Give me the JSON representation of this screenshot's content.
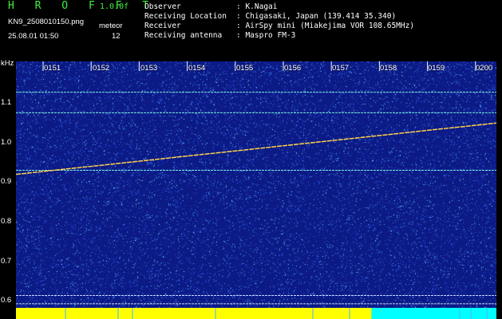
{
  "header": {
    "logo": "H R O F F T",
    "version": "1.0.0f",
    "filename": "KN9_2508010150.png",
    "datetime": "25.08.01 01:50",
    "meteor_label": "meteor",
    "meteor_count": "12",
    "info": [
      {
        "key": "Observer",
        "value": ": K.Nagai"
      },
      {
        "key": "Receiving Location",
        "value": ": Chigasaki, Japan (139.414 35.340)"
      },
      {
        "key": "Receiver",
        "value": ": AirSpy mini (Miakejima VOR 108.65MHz)"
      },
      {
        "key": "Receiving antenna",
        "value": ": Maspro FM-3"
      }
    ]
  },
  "spectrogram": {
    "y_unit": "kHz",
    "y_ticks": [
      "1.1",
      "1.0",
      "0.9",
      "0.8",
      "0.7",
      "0.6"
    ],
    "x_ticks": [
      "0151",
      "0152",
      "0153",
      "0154",
      "0155",
      "0156",
      "0157",
      "0158",
      "0159",
      "0200"
    ],
    "background_color": "#0c1a86",
    "horizontal_lines_khz": [
      1.105,
      1.055,
      0.915,
      0.61,
      0.59
    ],
    "sloped_signal_khz": {
      "start": 0.905,
      "end": 1.03
    },
    "power_bar": {
      "yellow_fraction": 0.74,
      "yellow_color": "#ffff00",
      "cyan_color": "#00ffff"
    }
  },
  "chart_data": {
    "type": "heatmap",
    "title": "",
    "xlabel": "",
    "ylabel": "kHz",
    "x": [
      "0151",
      "0152",
      "0153",
      "0154",
      "0155",
      "0156",
      "0157",
      "0158",
      "0159",
      "0200"
    ],
    "ylim": [
      0.58,
      1.18
    ],
    "series": [
      {
        "values": [
          0.905,
          1.03
        ]
      }
    ]
  }
}
